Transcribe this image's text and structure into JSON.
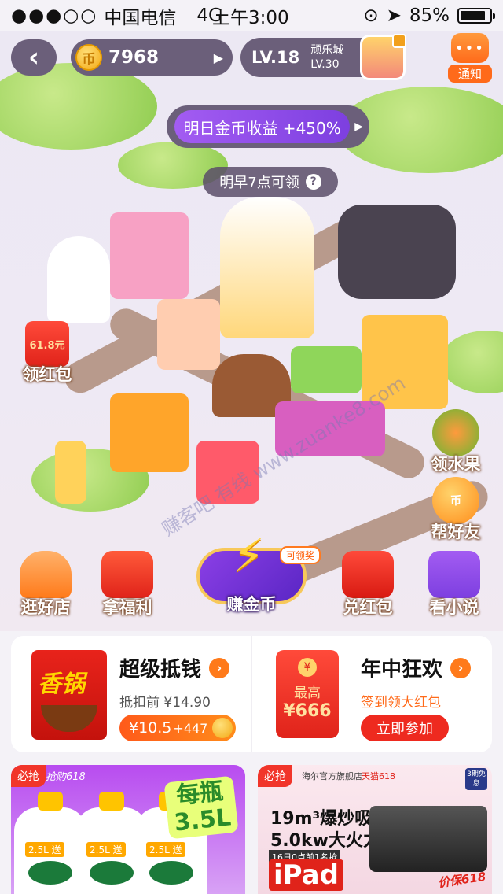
{
  "status_bar": {
    "signal": "●●●○○",
    "carrier": "中国电信",
    "network": "4G",
    "time": "上午3:00",
    "battery_percent": "85%",
    "battery_level": 0.85
  },
  "hud": {
    "back_icon": "back-chevron-icon",
    "coins": "7968",
    "level": "LV.18",
    "next_city_name": "顽乐城",
    "next_city_level": "LV.30",
    "notice_label": "通知",
    "notice_icon": "chat-bubble-icon"
  },
  "income": {
    "label": "明日金币收益 +450%",
    "claim_time": "明早7点可领",
    "help_icon": "?"
  },
  "side_buttons": {
    "red_packet_amount": "61.8元",
    "red_packet_label": "领红包",
    "fruit_label": "领水果",
    "help_friend_label": "帮好友"
  },
  "actions": {
    "shop": "逛好店",
    "benefit": "拿福利",
    "earn": "赚金币",
    "earn_badge": "可领奖",
    "redeem": "兑红包",
    "novel": "看小说"
  },
  "cards": {
    "left": {
      "title": "超级抵钱",
      "product_brand": "香锅",
      "original_price": "抵扣前 ¥14.90",
      "price": "¥10.5",
      "coins": "+447"
    },
    "right": {
      "title": "年中狂欢",
      "pack_label_1": "最高",
      "pack_label_2": "¥666",
      "subtitle": "签到领大红包",
      "button": "立即参加"
    }
  },
  "banners": {
    "left": {
      "tag": "必抢",
      "event": "抢购618",
      "volume_badge": "2.5L 送",
      "headline": "每瓶\n3.5L"
    },
    "right": {
      "tag": "必抢",
      "store": "海尔官方旗舰店",
      "event": "天猫618",
      "line1": "19m³爆炒吸力",
      "line2": "5.0kw大火力",
      "line3": "16日0点前1名抢",
      "ipad": "iPad",
      "corner": "3期免息",
      "promo": "价保618"
    }
  },
  "watermark": "赚客吧 有线 www.zuanke8.com",
  "colors": {
    "hud_bg": "#6b5f7a",
    "accent_orange": "#ff7a1a",
    "accent_red": "#ee2a1f",
    "income_purple": "#8b3fe6"
  }
}
